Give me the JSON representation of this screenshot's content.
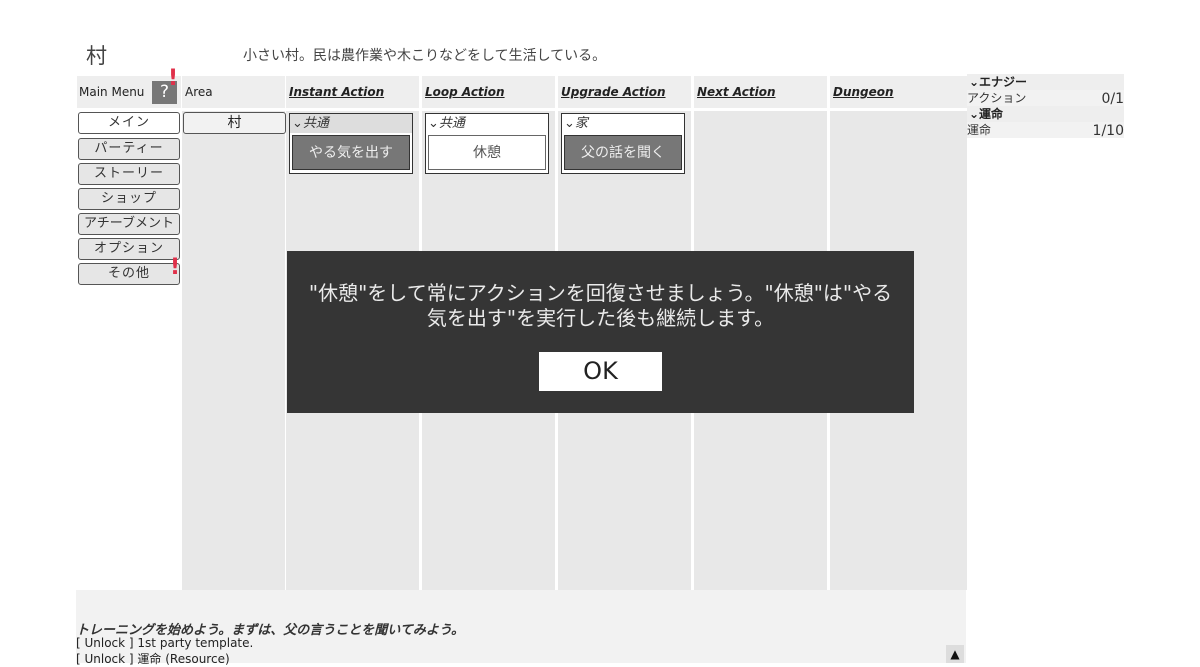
{
  "area_title": "村",
  "area_description": "小さい村。民は農作業や木こりなどをして生活している。",
  "header": {
    "main_menu": "Main Menu",
    "help": "?",
    "area": "Area",
    "columns": [
      "Instant Action",
      "Loop Action",
      "Upgrade Action",
      "Next Action",
      "Dungeon"
    ]
  },
  "alert_mark": "!",
  "menu_items": [
    {
      "label": "メイン",
      "active": true
    },
    {
      "label": "パーティー"
    },
    {
      "label": "ストーリー"
    },
    {
      "label": "ショップ"
    },
    {
      "label": "アチーブメント"
    },
    {
      "label": "オプション"
    },
    {
      "label": "その他"
    }
  ],
  "area_button": "村",
  "action_groups": [
    {
      "head": "⌄共通",
      "action": "やる気を出す"
    },
    {
      "head": "⌄共通",
      "action": "休憩"
    },
    {
      "head": "⌄家",
      "action": "父の話を聞く"
    }
  ],
  "resources": {
    "energy_head": "⌄エナジー",
    "energy_label": "アクション",
    "energy_value": "0/1",
    "fate_head": "⌄運命",
    "fate_label": "運命",
    "fate_value": "1/10"
  },
  "log": {
    "line1": "トレーニングを始めよう。まずは、父の言うことを聞いてみよう。",
    "line2": "[ Unlock ] 1st party template.",
    "line3": "[ Unlock ] 運命 (Resource)",
    "scroll_icon": "▲"
  },
  "dialog": {
    "message": "\"休憩\"をして常にアクションを回復させましょう。\"休憩\"は\"やる気を出す\"を実行した後も継続します。",
    "ok": "OK"
  }
}
